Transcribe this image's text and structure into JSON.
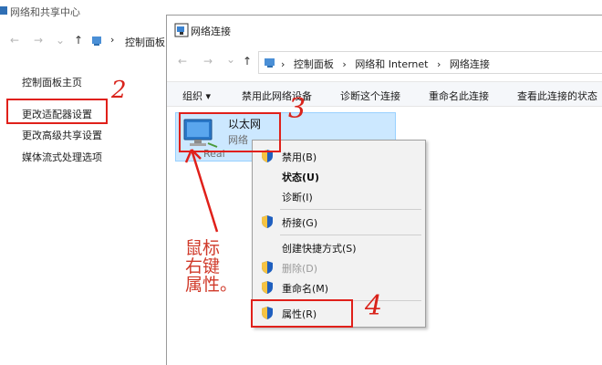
{
  "back_window": {
    "title": "网络和共享中心",
    "breadcrumb": "控制面板",
    "links": [
      "控制面板主页",
      "更改适配器设置",
      "更改高级共享设置",
      "媒体流式处理选项"
    ]
  },
  "front_window": {
    "title": "网络连接",
    "address": [
      "控制面板",
      "网络和 Internet",
      "网络连接"
    ],
    "toolbar": {
      "organize": "组织 ▾",
      "disable_device": "禁用此网络设备",
      "diagnose": "诊断这个连接",
      "rename": "重命名此连接",
      "view_status": "查看此连接的状态"
    },
    "adapter": {
      "name": "以太网",
      "status": "网络",
      "device": "Real"
    }
  },
  "context_menu": {
    "items": [
      {
        "label": "禁用(B)"
      },
      {
        "label": "状态(U)"
      },
      {
        "label": "诊断(I)"
      },
      {
        "label": "桥接(G)"
      },
      {
        "label": "创建快捷方式(S)"
      },
      {
        "label": "删除(D)"
      },
      {
        "label": "重命名(M)"
      },
      {
        "label": "属性(R)"
      }
    ]
  },
  "annotations": {
    "step2": "2",
    "step3": "3",
    "step4": "4",
    "handwriting": "鼠标\n右键\n属性。"
  },
  "colors": {
    "annotation_red": "#e0201a",
    "selection_blue": "#cce8ff",
    "shield_blue": "#1f5fbf",
    "shield_yellow": "#f6c342"
  }
}
